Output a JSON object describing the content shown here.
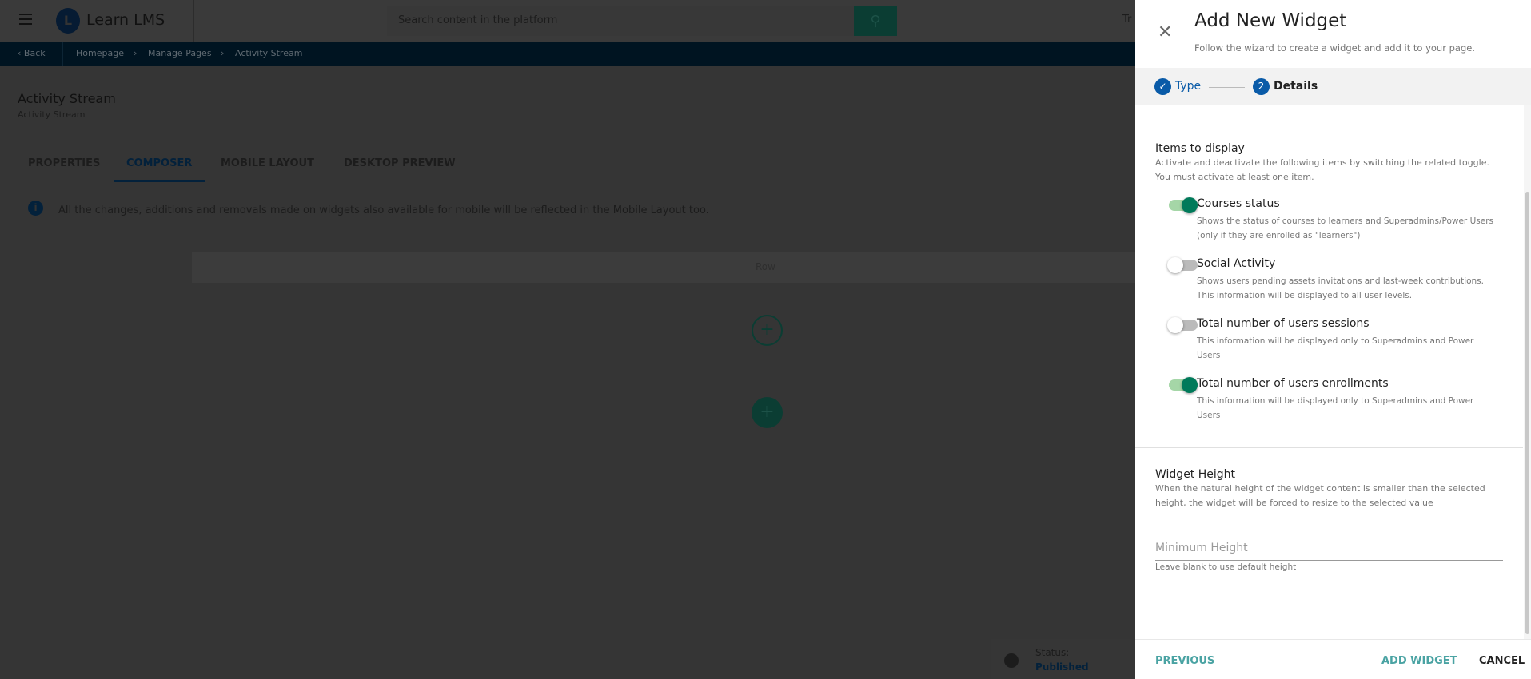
{
  "header": {
    "logo_text": "Learn LMS",
    "search_placeholder": "Search content in the platform",
    "truncated_text": "Tr"
  },
  "breadcrumb": {
    "back": "Back",
    "items": [
      "Homepage",
      "Manage Pages",
      "Activity Stream"
    ]
  },
  "page": {
    "title": "Activity Stream",
    "subtitle": "Activity Stream"
  },
  "tabs": [
    {
      "label": "PROPERTIES"
    },
    {
      "label": "COMPOSER",
      "active": true
    },
    {
      "label": "MOBILE LAYOUT"
    },
    {
      "label": "DESKTOP PREVIEW"
    }
  ],
  "info_text": "All the changes, additions and removals made on widgets also available for mobile will be reflected in the Mobile Layout too.",
  "composer": {
    "row_label": "Row"
  },
  "status": {
    "label": "Status:",
    "value": "Published"
  },
  "panel": {
    "title": "Add New Widget",
    "subtitle": "Follow the wizard to create a widget and add it to your page.",
    "steps": [
      {
        "label": "Type",
        "state": "done"
      },
      {
        "number": "2",
        "label": "Details",
        "state": "current"
      }
    ],
    "items_section": {
      "title": "Items to display",
      "desc1": "Activate and deactivate the following items by switching the related toggle.",
      "desc2": "You must activate at least one item.",
      "items": [
        {
          "label": "Courses status",
          "on": true,
          "d1": "Shows the status of courses to learners and Superadmins/Power Users",
          "d2": "(only if they are enrolled as \"learners\")"
        },
        {
          "label": "Social Activity",
          "on": false,
          "d1": "Shows users pending assets invitations and last-week contributions.",
          "d2": "This information will be displayed to all user levels."
        },
        {
          "label": "Total number of users sessions",
          "on": false,
          "d1": "This information will be displayed only to Superadmins and Power",
          "d2": "Users"
        },
        {
          "label": "Total number of users enrollments",
          "on": true,
          "d1": "This information will be displayed only to Superadmins and Power",
          "d2": "Users"
        }
      ]
    },
    "height_section": {
      "title": "Widget Height",
      "desc1": "When the natural height of the widget content is smaller than the selected",
      "desc2": "height, the widget will be forced to resize to the selected value",
      "placeholder": "Minimum Height",
      "helper": "Leave blank to use default height"
    },
    "footer": {
      "previous": "PREVIOUS",
      "add": "ADD WIDGET",
      "cancel": "CANCEL"
    }
  },
  "colors": {
    "primary": "#0a5ba8",
    "accent": "#007a5a",
    "teal_button": "#4aa3a3"
  }
}
